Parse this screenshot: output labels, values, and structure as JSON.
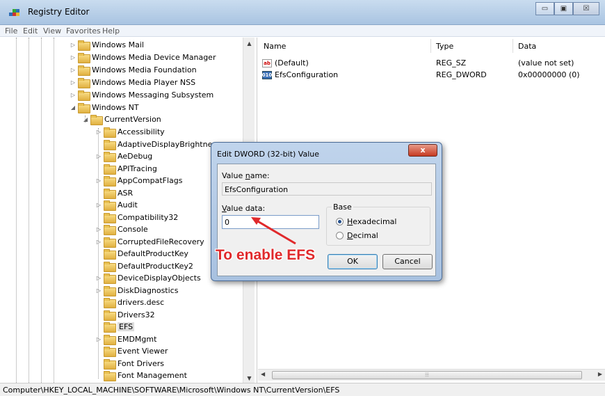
{
  "window": {
    "title": "Registry Editor",
    "minimize_glyph": "▭",
    "maximize_glyph": "▣",
    "close_glyph": "☒"
  },
  "menu": [
    "File",
    "Edit",
    "View",
    "Favorites",
    "Help"
  ],
  "tree": {
    "top_items": [
      {
        "label": "Windows Mail",
        "expander": "▷"
      },
      {
        "label": "Windows Media Device Manager",
        "expander": "▷"
      },
      {
        "label": "Windows Media Foundation",
        "expander": "▷"
      },
      {
        "label": "Windows Media Player NSS",
        "expander": "▷"
      },
      {
        "label": "Windows Messaging Subsystem",
        "expander": "▷"
      },
      {
        "label": "Windows NT",
        "expander": "◢"
      }
    ],
    "current_version": {
      "label": "CurrentVersion",
      "expander": "◢"
    },
    "children": [
      {
        "label": "Accessibility",
        "expander": "▷"
      },
      {
        "label": "AdaptiveDisplayBrightness",
        "expander": ""
      },
      {
        "label": "AeDebug",
        "expander": "▷"
      },
      {
        "label": "APITracing",
        "expander": ""
      },
      {
        "label": "AppCompatFlags",
        "expander": "▷"
      },
      {
        "label": "ASR",
        "expander": ""
      },
      {
        "label": "Audit",
        "expander": "▷"
      },
      {
        "label": "Compatibility32",
        "expander": ""
      },
      {
        "label": "Console",
        "expander": "▷"
      },
      {
        "label": "CorruptedFileRecovery",
        "expander": "▷"
      },
      {
        "label": "DefaultProductKey",
        "expander": ""
      },
      {
        "label": "DefaultProductKey2",
        "expander": ""
      },
      {
        "label": "DeviceDisplayObjects",
        "expander": "▷"
      },
      {
        "label": "DiskDiagnostics",
        "expander": "▷"
      },
      {
        "label": "drivers.desc",
        "expander": ""
      },
      {
        "label": "Drivers32",
        "expander": ""
      },
      {
        "label": "EFS",
        "expander": "",
        "selected": true
      },
      {
        "label": "EMDMgmt",
        "expander": "▷"
      },
      {
        "label": "Event Viewer",
        "expander": ""
      },
      {
        "label": "Font Drivers",
        "expander": ""
      },
      {
        "label": "Font Management",
        "expander": ""
      }
    ],
    "scroll_up": "▲",
    "scroll_down": "▼"
  },
  "list": {
    "columns": [
      "Name",
      "Type",
      "Data"
    ],
    "rows": [
      {
        "icon": "string-value-icon",
        "icon_text": "ab",
        "name": "(Default)",
        "type": "REG_SZ",
        "data": "(value not set)"
      },
      {
        "icon": "dword-value-icon",
        "icon_text": "010",
        "name": "EfsConfiguration",
        "type": "REG_DWORD",
        "data": "0x00000000 (0)"
      }
    ],
    "hscroll_left": "◀",
    "hscroll_right": "▶",
    "hscroll_grip": "⦙⦙⦙"
  },
  "status": {
    "path": "Computer\\HKEY_LOCAL_MACHINE\\SOFTWARE\\Microsoft\\Windows NT\\CurrentVersion\\EFS"
  },
  "dialog": {
    "title": "Edit DWORD (32-bit) Value",
    "close_label": "x",
    "value_name_pre": "Value ",
    "value_name_mnemonic": "n",
    "value_name_post": "ame:",
    "value_name": "EfsConfiguration",
    "value_data_mnemonic": "V",
    "value_data_post": "alue data:",
    "value_data": "0",
    "base_label": "Base",
    "hex_mnemonic": "H",
    "hex_post": "exadecimal",
    "dec_mnemonic": "D",
    "dec_post": "ecimal",
    "hex_checked": true,
    "ok": "OK",
    "cancel": "Cancel"
  },
  "annotation": {
    "text": "To enable EFS",
    "color": "#e0292b"
  }
}
